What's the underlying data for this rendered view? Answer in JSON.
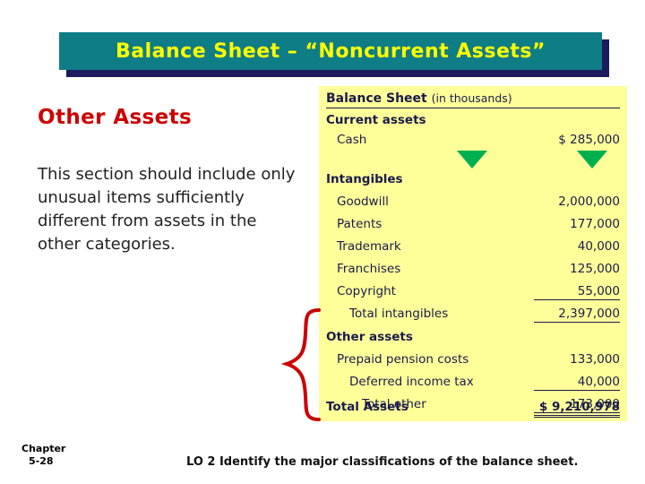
{
  "slide": {
    "title": "Balance Sheet – “Noncurrent Assets”"
  },
  "left": {
    "heading": "Other Assets",
    "body": "This section should include only unusual items sufficiently different from assets in the other categories."
  },
  "sheet": {
    "header_title": "Balance Sheet",
    "header_units": "(in thousands)",
    "rows": [
      {
        "label": "Current assets",
        "amount": "",
        "style": "bold"
      },
      {
        "label": "Cash",
        "amount": "$  285,000",
        "style": "ind1"
      },
      {
        "label": "Intangibles",
        "amount": "",
        "style": "bold"
      },
      {
        "label": "Goodwill",
        "amount": "2,000,000",
        "style": "ind1"
      },
      {
        "label": "Patents",
        "amount": "177,000",
        "style": "ind1"
      },
      {
        "label": "Trademark",
        "amount": "40,000",
        "style": "ind1"
      },
      {
        "label": "Franchises",
        "amount": "125,000",
        "style": "ind1"
      },
      {
        "label": "Copyright",
        "amount": "55,000",
        "style": "ind1-underline"
      },
      {
        "label": "Total intangibles",
        "amount": "2,397,000",
        "style": "ind2-underline"
      },
      {
        "label": "Other assets",
        "amount": "",
        "style": "bold"
      },
      {
        "label": "Prepaid pension costs",
        "amount": "133,000",
        "style": "ind1"
      },
      {
        "label": "Deferred income tax",
        "amount": "40,000",
        "style": "ind1-underline"
      },
      {
        "label": "Total other",
        "amount": "173,000",
        "style": "ind2-underline"
      },
      {
        "label": "Total Assets",
        "amount": "$ 9,210,978",
        "style": "bold-double"
      }
    ]
  },
  "footer": {
    "chapter_word": "Chapter",
    "chapter_number": "5-28",
    "note": "LO 2  Identify the major classifications of the balance sheet."
  },
  "colors": {
    "banner": "#0f7d86",
    "banner_shadow": "#1b1b5e",
    "title_text": "#ffff00",
    "heading_red": "#cc0000",
    "panel": "#ffff99",
    "sheet_text": "#1a1a4d",
    "triangle_green": "#00b050",
    "brace_red": "#cc0000"
  }
}
